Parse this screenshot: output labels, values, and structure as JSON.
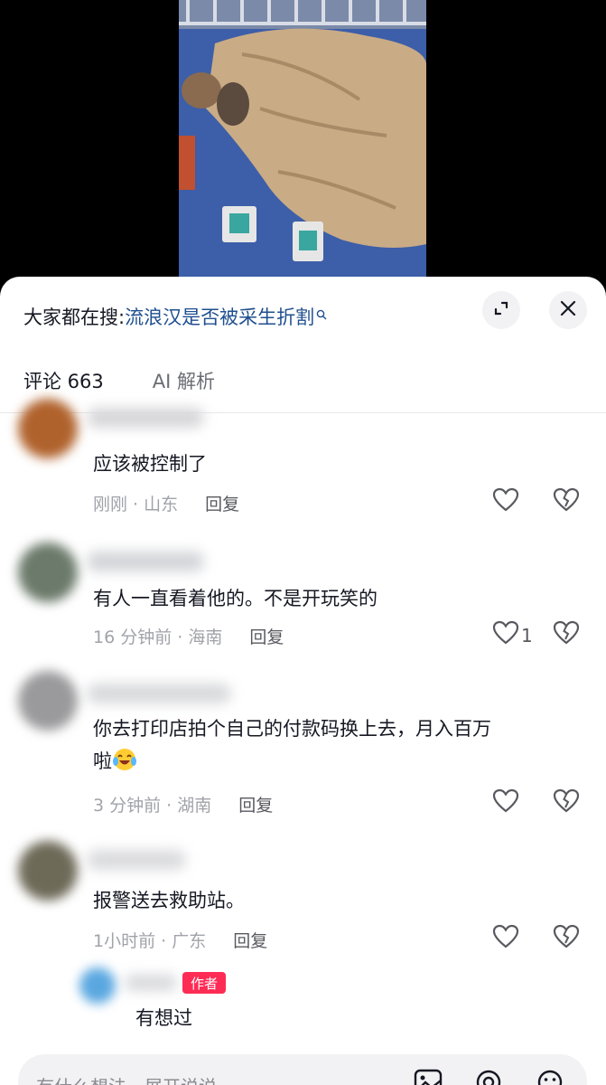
{
  "search": {
    "prefix": "大家都在搜:",
    "query": "流浪汉是否被采生折割",
    "magnifier_icon": "search-icon"
  },
  "tabs": [
    {
      "label": "评论 663",
      "active": true
    },
    {
      "label": "AI 解析",
      "active": false
    }
  ],
  "comments": [
    {
      "text": "应该被控制了",
      "time_loc": "刚刚 · 山东",
      "reply": "回复",
      "likes": ""
    },
    {
      "text": "有人一直看着他的。不是开玩笑的",
      "time_loc": "16 分钟前 · 海南",
      "reply": "回复",
      "likes": "1"
    },
    {
      "text_line1": "你去打印店拍个自己的付款码换上去，月入百万",
      "text_line2": "啦",
      "emoji": "laughing-crying-emoji",
      "time_loc": "3 分钟前 · 湖南",
      "reply": "回复",
      "likes": ""
    },
    {
      "text": "报警送去救助站。",
      "time_loc": "1小时前 · 广东",
      "reply": "回复",
      "likes": ""
    }
  ],
  "author_reply": {
    "badge": "作者",
    "text": "有想过"
  },
  "input": {
    "placeholder": "有什么想法，展开说说"
  },
  "colors": {
    "accent_link": "#1f4f8f",
    "author_badge": "#fe2c55",
    "meta_gray": "#a1a3aa"
  }
}
